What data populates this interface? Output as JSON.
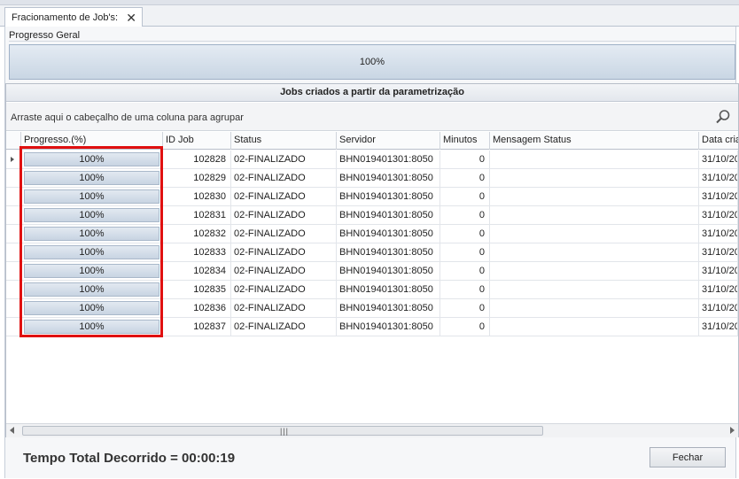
{
  "tab": {
    "title": "Fracionamento de Job's:",
    "close_glyph": "✕"
  },
  "overall": {
    "label": "Progresso Geral",
    "progress_text": "100%",
    "progress": 1.0
  },
  "grid": {
    "title": "Jobs criados a partir da parametrização",
    "group_hint": "Arraste aqui o cabeçalho de uma coluna para agrupar",
    "columns": [
      "Progresso.(%)",
      "ID Job",
      "Status",
      "Servidor",
      "Minutos",
      "Mensagem Status",
      "Data cria"
    ],
    "rows": [
      {
        "progress": "100%",
        "id": "102828",
        "status": "02-FINALIZADO",
        "server": "BHN019401301:8050",
        "minutes": "0",
        "message": "",
        "date": "31/10/20"
      },
      {
        "progress": "100%",
        "id": "102829",
        "status": "02-FINALIZADO",
        "server": "BHN019401301:8050",
        "minutes": "0",
        "message": "",
        "date": "31/10/20"
      },
      {
        "progress": "100%",
        "id": "102830",
        "status": "02-FINALIZADO",
        "server": "BHN019401301:8050",
        "minutes": "0",
        "message": "",
        "date": "31/10/20"
      },
      {
        "progress": "100%",
        "id": "102831",
        "status": "02-FINALIZADO",
        "server": "BHN019401301:8050",
        "minutes": "0",
        "message": "",
        "date": "31/10/20"
      },
      {
        "progress": "100%",
        "id": "102832",
        "status": "02-FINALIZADO",
        "server": "BHN019401301:8050",
        "minutes": "0",
        "message": "",
        "date": "31/10/20"
      },
      {
        "progress": "100%",
        "id": "102833",
        "status": "02-FINALIZADO",
        "server": "BHN019401301:8050",
        "minutes": "0",
        "message": "",
        "date": "31/10/20"
      },
      {
        "progress": "100%",
        "id": "102834",
        "status": "02-FINALIZADO",
        "server": "BHN019401301:8050",
        "minutes": "0",
        "message": "",
        "date": "31/10/20"
      },
      {
        "progress": "100%",
        "id": "102835",
        "status": "02-FINALIZADO",
        "server": "BHN019401301:8050",
        "minutes": "0",
        "message": "",
        "date": "31/10/20"
      },
      {
        "progress": "100%",
        "id": "102836",
        "status": "02-FINALIZADO",
        "server": "BHN019401301:8050",
        "minutes": "0",
        "message": "",
        "date": "31/10/20"
      },
      {
        "progress": "100%",
        "id": "102837",
        "status": "02-FINALIZADO",
        "server": "BHN019401301:8050",
        "minutes": "0",
        "message": "",
        "date": "31/10/20"
      }
    ],
    "scrollbar_grip": "|||"
  },
  "footer": {
    "elapsed": "Tempo Total Decorrido = 00:00:19",
    "close_label": "Fechar"
  },
  "colors": {
    "highlight": "#e01010",
    "progress_fill": "#c8d4e2"
  }
}
